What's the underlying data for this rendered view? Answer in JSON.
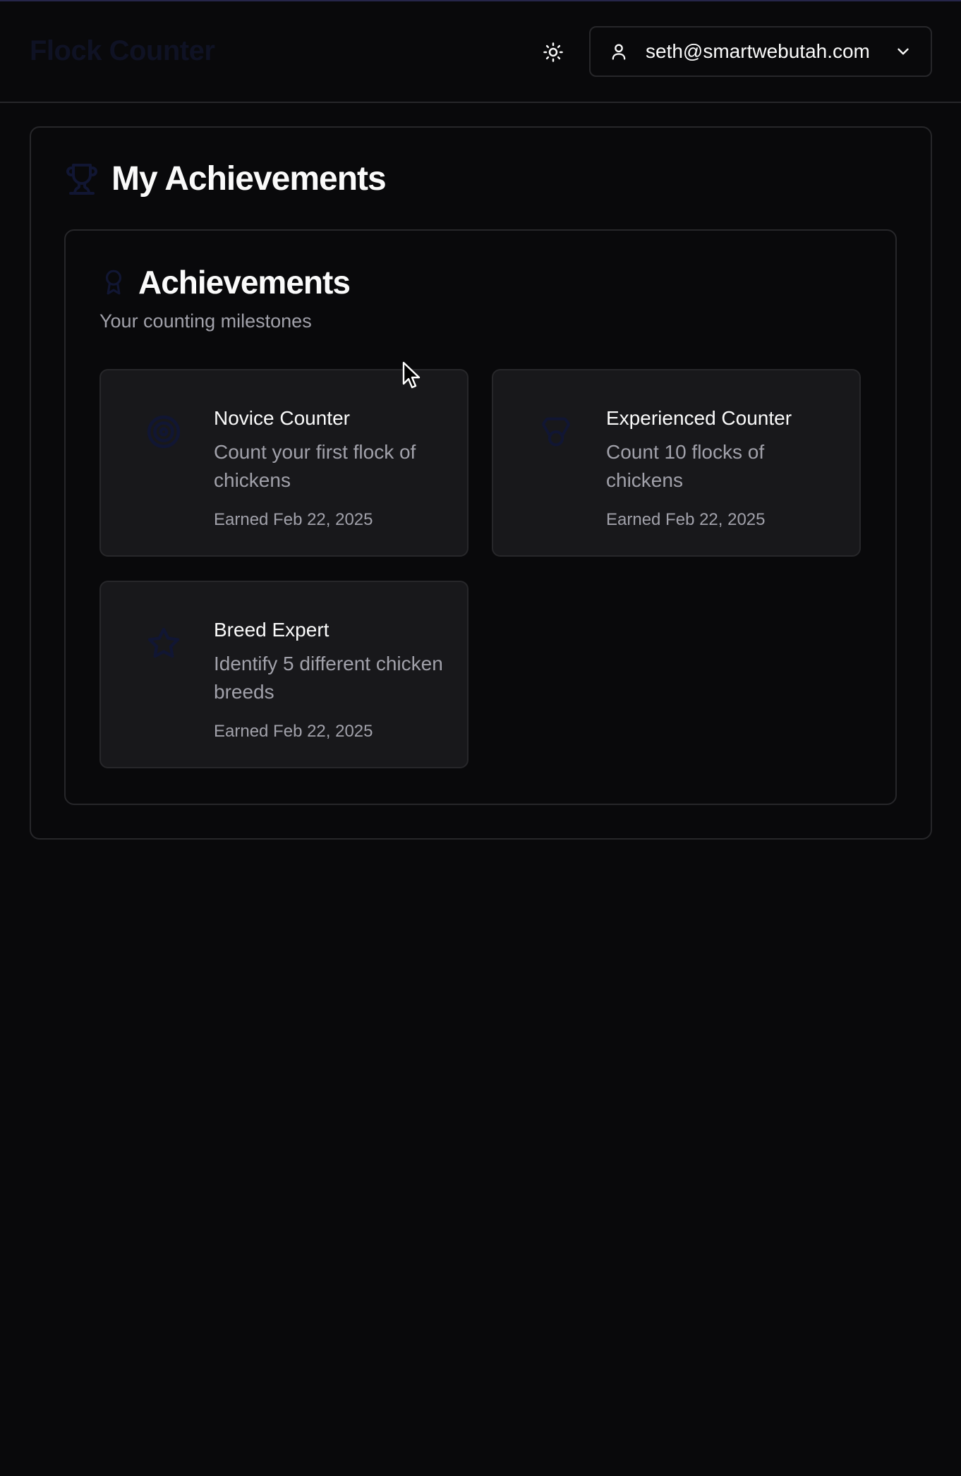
{
  "header": {
    "brand": "Flock Counter",
    "user_email": "seth@smartwebutah.com",
    "theme_icon": "sun-icon",
    "user_icon": "user-icon",
    "dropdown_icon": "chevron-down-icon"
  },
  "page": {
    "title": "My Achievements",
    "title_icon": "trophy-icon"
  },
  "section": {
    "title": "Achievements",
    "title_icon": "award-icon",
    "subtitle": "Your counting milestones"
  },
  "achievements": [
    {
      "name": "Novice Counter",
      "description": "Count your first flock of chickens",
      "earned": "Earned Feb 22, 2025",
      "icon": "target-icon"
    },
    {
      "name": "Experienced Counter",
      "description": "Count 10 flocks of chickens",
      "earned": "Earned Feb 22, 2025",
      "icon": "medal-icon"
    },
    {
      "name": "Breed Expert",
      "description": "Identify 5 different chicken breeds",
      "earned": "Earned Feb 22, 2025",
      "icon": "star-icon"
    }
  ],
  "colors": {
    "background": "#09090b",
    "card": "#18181b",
    "border": "#27272a",
    "muted_text": "#a1a1aa",
    "icon_dim": "#111633"
  }
}
